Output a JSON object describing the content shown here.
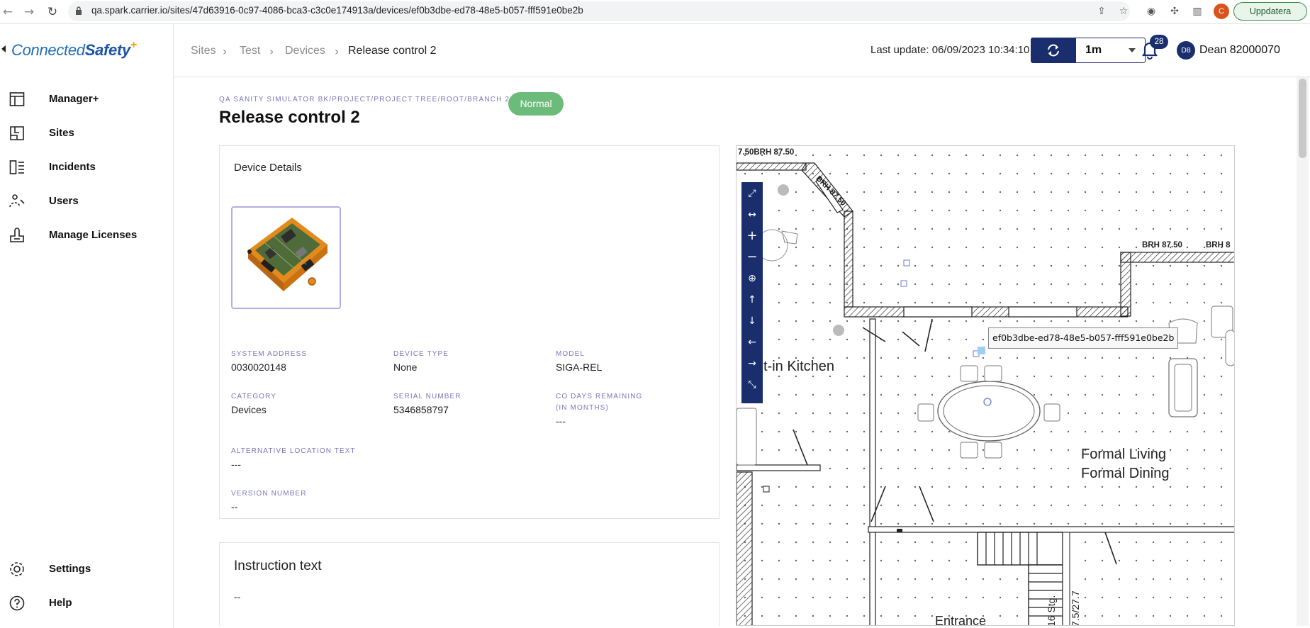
{
  "browser": {
    "url": "qa.spark.carrier.io/sites/47d63916-0c97-4086-bca3-c3c0e174913a/devices/ef0b3dbe-ed78-48e5-b057-fff591e0be2b",
    "profile_initial": "C",
    "update_label": "Uppdatera"
  },
  "sidebar": {
    "logo_regular": "Connected",
    "logo_bold": "Safety",
    "logo_plus": "+",
    "items": [
      {
        "label": "Manager+",
        "icon": "dashboard-icon"
      },
      {
        "label": "Sites",
        "icon": "floorplan-icon"
      },
      {
        "label": "Incidents",
        "icon": "incidents-icon"
      },
      {
        "label": "Users",
        "icon": "users-icon"
      },
      {
        "label": "Manage Licenses",
        "icon": "license-icon"
      }
    ],
    "bottom_items": [
      {
        "label": "Settings",
        "icon": "gear-icon"
      },
      {
        "label": "Help",
        "icon": "help-icon"
      }
    ]
  },
  "header": {
    "breadcrumb": [
      "Sites",
      "Test",
      "Devices",
      "Release control 2"
    ],
    "last_update": "Last update: 06/09/2023 10:34:10",
    "refresh_interval": "1m",
    "notification_count": "28",
    "user_initials": "D8",
    "user_name": "Dean 82000070"
  },
  "page": {
    "path": "QA SANITY SIMULATOR BK/PROJECT/PROJECT TREE/ROOT/BRANCH 2",
    "status": "Normal",
    "status_color": "#6cbb7a",
    "title": "Release control 2"
  },
  "details": {
    "card_title": "Device Details",
    "system_address": {
      "label": "SYSTEM ADDRESS",
      "value": "0030020148"
    },
    "device_type": {
      "label": "DEVICE TYPE",
      "value": "None"
    },
    "model": {
      "label": "MODEL",
      "value": "SIGA-REL"
    },
    "category": {
      "label": "CATEGORY",
      "value": "Devices"
    },
    "serial_number": {
      "label": "SERIAL NUMBER",
      "value": "5346858797"
    },
    "co_days_label_1": "CO DAYS REMAINING",
    "co_days_label_2": "(IN MONTHS)",
    "co_days_value": "---",
    "alt_location": {
      "label": "ALTERNATIVE LOCATION TEXT",
      "value": "---"
    },
    "version": {
      "label": "VERSION NUMBER",
      "value": "--"
    }
  },
  "instruction": {
    "title": "Instruction text",
    "value": "--"
  },
  "map": {
    "tooltip": "ef0b3dbe-ed78-48e5-b057-fff591e0be2b",
    "label_top_left": "7.50BRH 87.50",
    "label_diagonal": "BRH 87.50",
    "label_top_right_1": "BRH 87.50",
    "label_top_right_2": "BRH 8",
    "kitchen": "t-in Kitchen",
    "living_1": "Formal Living",
    "living_2": "Formal Dining",
    "entrance": "Entrance",
    "stairs": "16 Stg.",
    "stairs_2": "7.5/27.7",
    "tools": [
      "fit-screen-icon",
      "fit-width-icon",
      "zoom-in-icon",
      "zoom-out-icon",
      "zoom-reset-icon",
      "pan-up-icon",
      "pan-down-icon",
      "pan-left-icon",
      "pan-right-icon",
      "shrink-icon"
    ]
  }
}
